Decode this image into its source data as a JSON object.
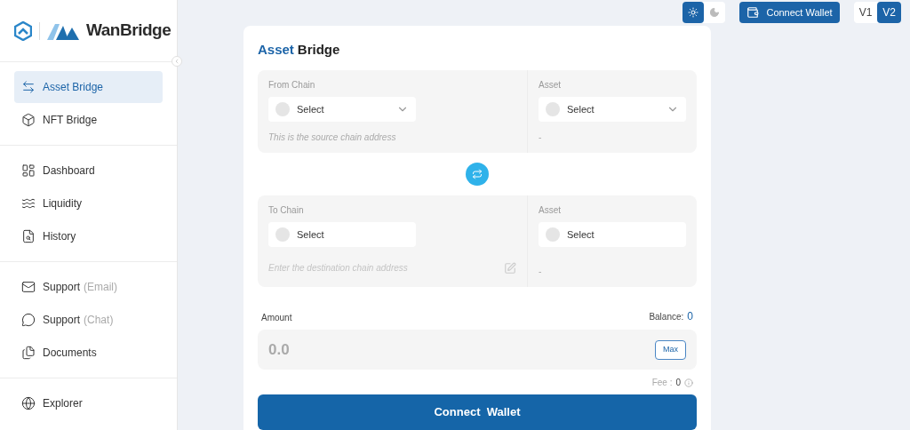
{
  "logo": {
    "text": "WanBridge"
  },
  "nav_groups": [
    [
      {
        "label": "Asset Bridge",
        "selected": true
      },
      {
        "label": "NFT Bridge",
        "selected": false
      }
    ],
    [
      {
        "label": "Dashboard",
        "selected": false
      },
      {
        "label": "Liquidity",
        "selected": false
      },
      {
        "label": "History",
        "selected": false
      }
    ],
    [
      {
        "label": "Support",
        "note": "(Email)",
        "selected": false
      },
      {
        "label": "Support",
        "note": "(Chat)",
        "selected": false
      },
      {
        "label": "Documents",
        "selected": false
      }
    ],
    [
      {
        "label": "Explorer",
        "selected": false
      }
    ]
  ],
  "theme_toggle": [
    {
      "kind": "light",
      "selected": true
    },
    {
      "kind": "dark",
      "selected": false
    }
  ],
  "top_connect": {
    "label": "Connect Wallet"
  },
  "versions": [
    {
      "label": "V1",
      "selected": false
    },
    {
      "label": "V2",
      "selected": true
    }
  ],
  "card": {
    "title_lead": "Asset",
    "title": "Bridge",
    "sections": [
      {
        "chain_label": "From Chain",
        "chain_select": "Select",
        "chain_caret": true,
        "address": {
          "kind": "note",
          "text": "This is the source chain address"
        },
        "asset_label": "Asset",
        "asset_select": "Select",
        "asset_caret": true,
        "asset_note": "-"
      },
      {
        "chain_label": "To Chain",
        "chain_select": "Select",
        "chain_caret": false,
        "address": {
          "kind": "input",
          "placeholder": "Enter the destination chain address"
        },
        "asset_label": "Asset",
        "asset_select": "Select",
        "asset_caret": false,
        "asset_note": "-"
      }
    ],
    "amount_label": "Amount",
    "balance_label": "Balance:",
    "balance": "0",
    "amount_placeholder": "0.0",
    "max": "Max",
    "fee_label": "Fee :",
    "fee": "0",
    "connect": "Connect  Wallet"
  }
}
